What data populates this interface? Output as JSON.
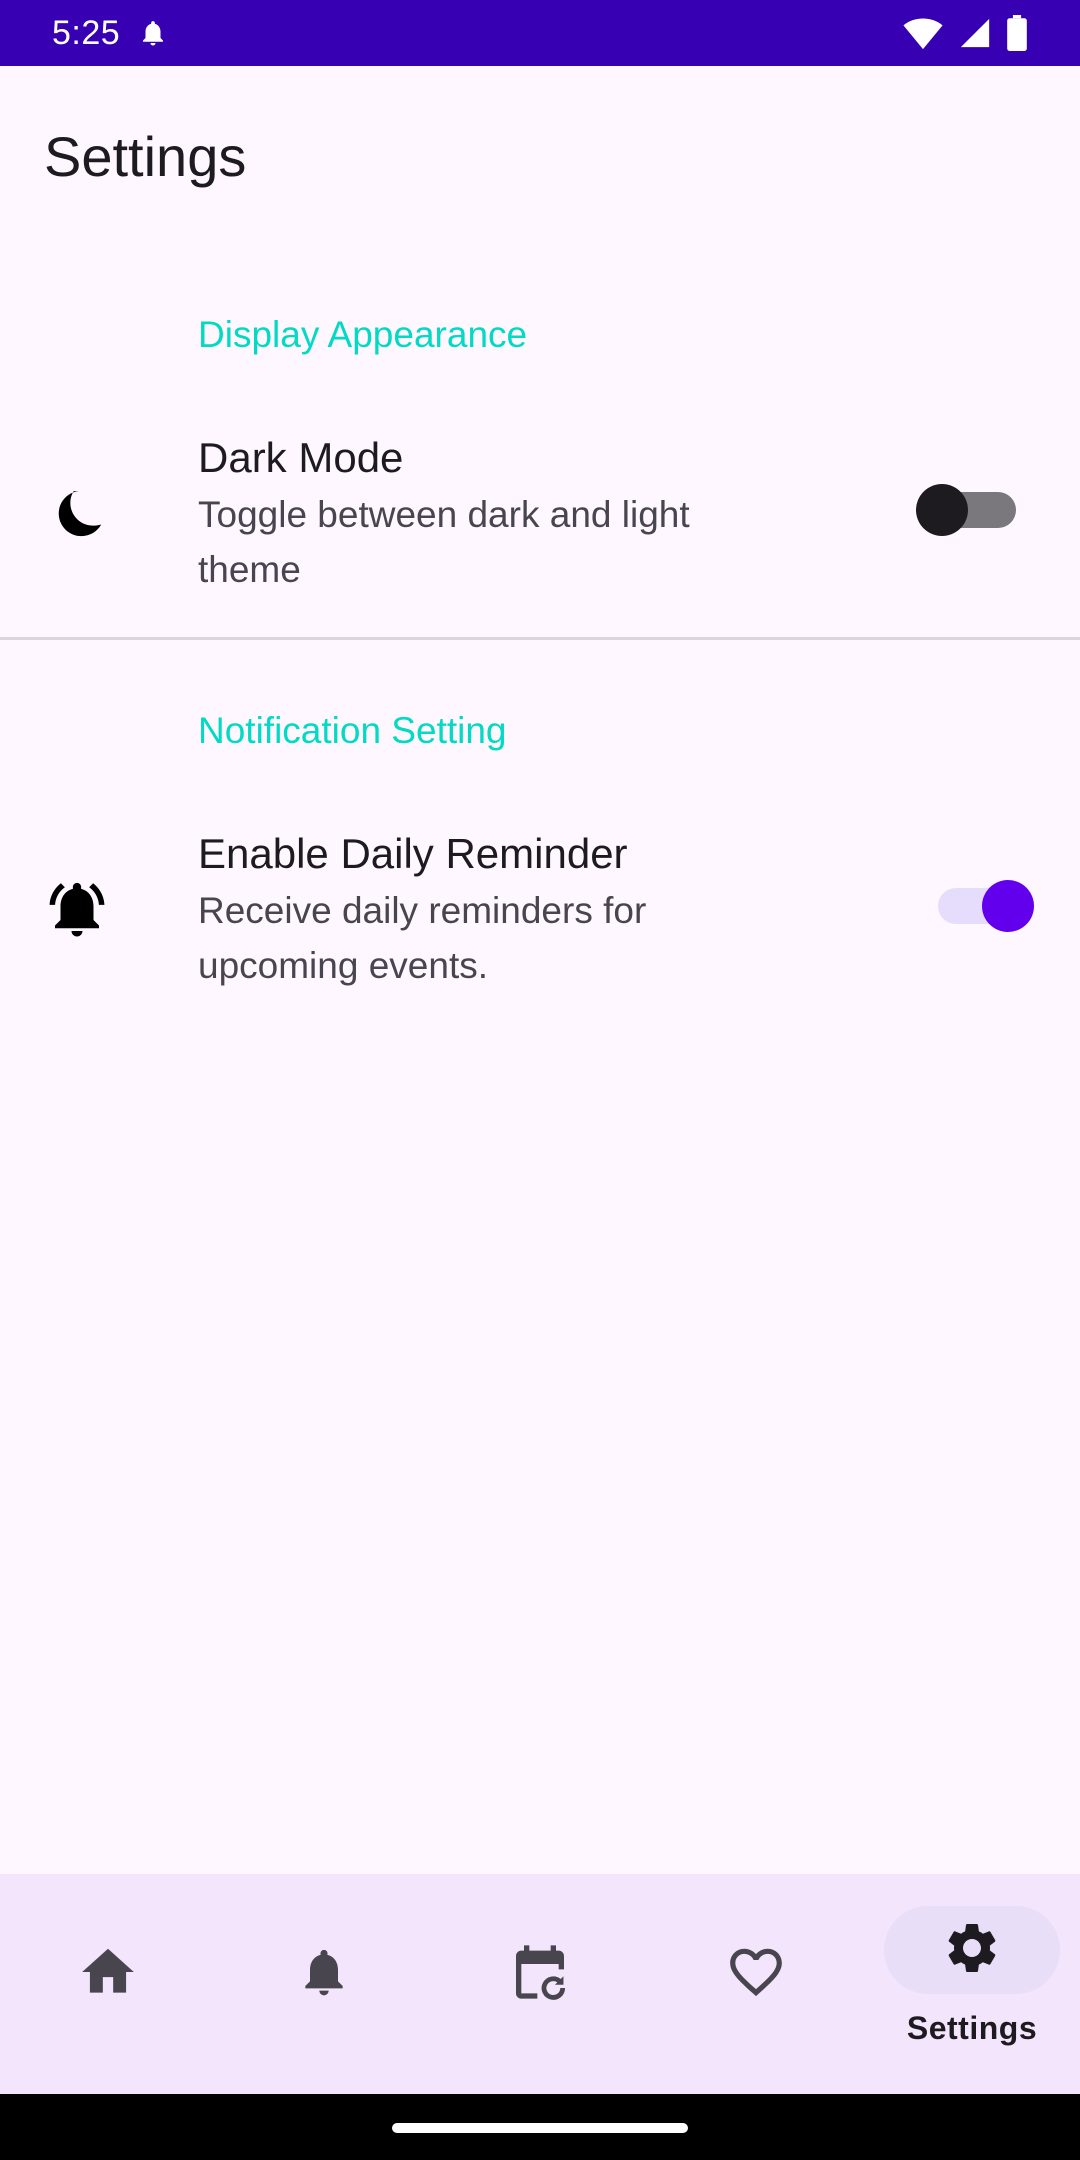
{
  "status_bar": {
    "time": "5:25",
    "icons": [
      "notification-bell-icon",
      "wifi-icon",
      "signal-icon",
      "battery-icon"
    ]
  },
  "app_bar": {
    "title": "Settings"
  },
  "sections": [
    {
      "header": "Display Appearance",
      "item": {
        "icon": "moon-icon",
        "title": "Dark Mode",
        "summary": "Toggle between dark and light theme",
        "switch_on": false
      }
    },
    {
      "header": "Notification Setting",
      "item": {
        "icon": "bell-ringing-icon",
        "title": "Enable Daily Reminder",
        "summary": "Receive daily reminders for upcoming events.",
        "switch_on": true
      }
    }
  ],
  "bottom_nav": {
    "items": [
      {
        "icon": "home-icon",
        "label": ""
      },
      {
        "icon": "bell-icon",
        "label": ""
      },
      {
        "icon": "calendar-refresh-icon",
        "label": ""
      },
      {
        "icon": "heart-icon",
        "label": ""
      },
      {
        "icon": "gear-icon",
        "label": "Settings",
        "active": true
      }
    ]
  },
  "colors": {
    "status_bar": "#3700B3",
    "section_header": "#03DAC5",
    "switch_on": "#6200EE",
    "background": "#FEF7FF",
    "nav_background": "#F3E5FB"
  }
}
